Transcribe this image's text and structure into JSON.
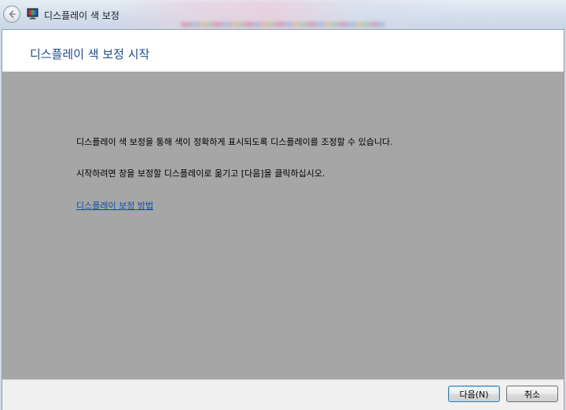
{
  "window": {
    "title": "디스플레이 색 보정"
  },
  "header": {
    "title": "디스플레이 색 보정 시작"
  },
  "main": {
    "paragraph_1": "디스플레이 색 보정을 통해 색이 정확하게 표시되도록 디스플레이를 조정할 수 있습니다.",
    "paragraph_2": "시작하려면 창을 보정할 디스플레이로 옮기고 [다음]을 클릭하십시오.",
    "help_link": "디스플레이 보정 방법"
  },
  "footer": {
    "next_label": "다음(N)",
    "cancel_label": "취소"
  },
  "icons": {
    "back": "back-arrow-icon",
    "app": "monitor-color-icon"
  },
  "colors": {
    "header_title": "#1f4a8a",
    "main_background": "#a6a6a6",
    "link": "#0a4fa8"
  }
}
